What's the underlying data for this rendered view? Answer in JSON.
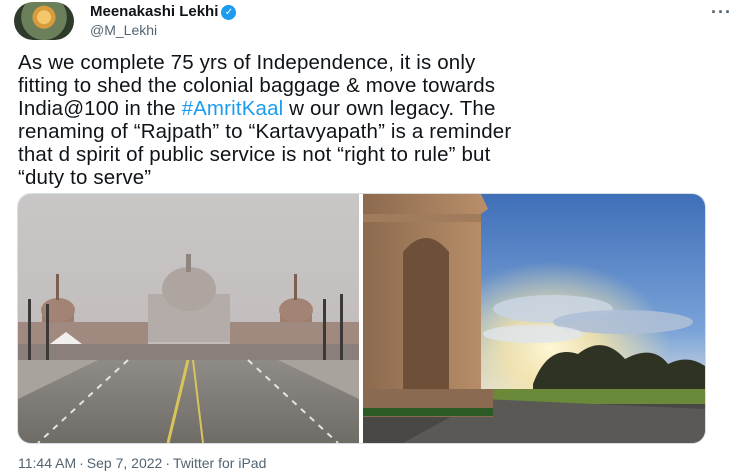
{
  "author": {
    "name": "Meenakashi Lekhi",
    "handle": "@M_Lekhi",
    "verified_mark": "✓"
  },
  "menu": {
    "more_label": "···"
  },
  "tweet": {
    "text_before": "As we complete 75 yrs of Independence, it is only\nfitting to shed the colonial baggage & move towards\nIndia@100 in the ",
    "hashtag": "#AmritKaal",
    "text_after": " w our own legacy. The\nrenaming of “Rajpath” to “Kartavyapath” is a reminder\nthat d spirit of public service is not “right to rule” but\n“duty to serve”"
  },
  "media": {
    "photos": [
      {
        "icon": "rajpath-photo"
      },
      {
        "icon": "india-gate-photo"
      }
    ]
  },
  "footer": {
    "time": "11:44 AM",
    "date": "Sep 7, 2022",
    "source": "Twitter for iPad",
    "separator": "·"
  },
  "colors": {
    "link": "#1d9bf0",
    "secondary_text": "#536471",
    "verified": "#1d9bf0"
  }
}
